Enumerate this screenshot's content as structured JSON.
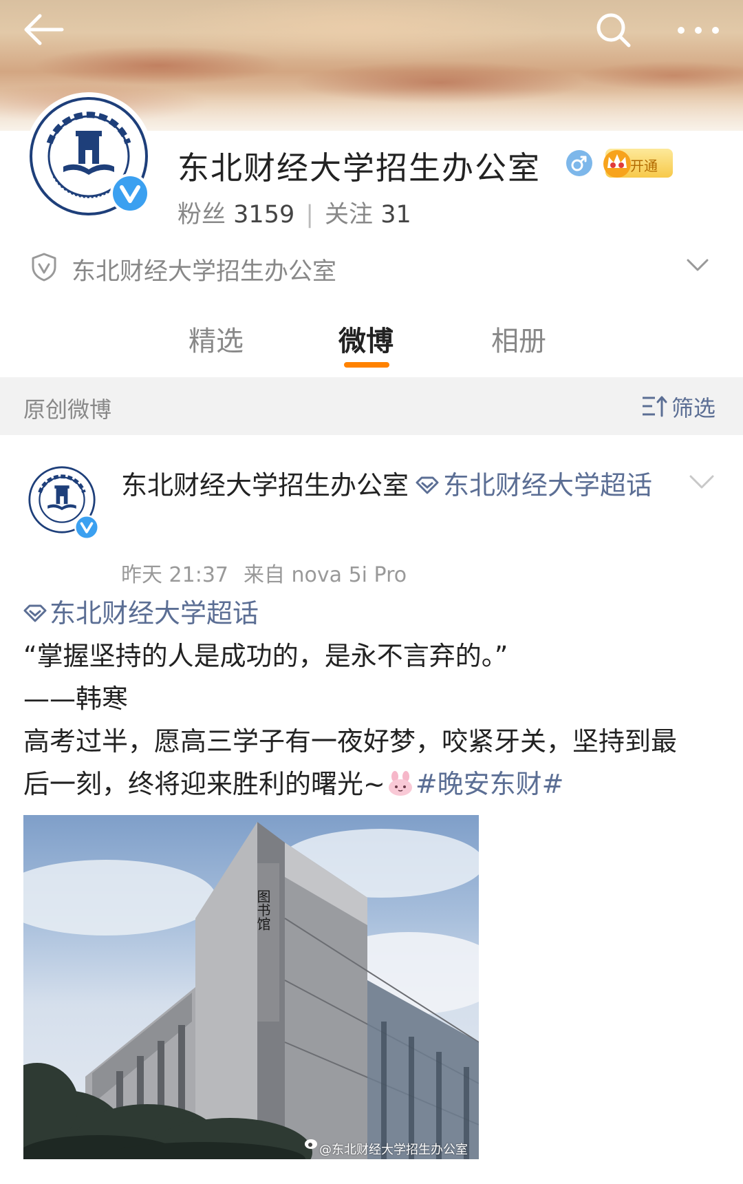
{
  "profile": {
    "name": "东北财经大学招生办公室",
    "vip_label": "开通",
    "fans_label": "粉丝",
    "fans_count": "3159",
    "follow_label": "关注",
    "follow_count": "31",
    "separator": "|",
    "certification": "东北财经大学招生办公室",
    "gender": "male",
    "verified": true
  },
  "tabs": [
    {
      "label": "精选",
      "active": false
    },
    {
      "label": "微博",
      "active": true
    },
    {
      "label": "相册",
      "active": false
    }
  ],
  "filter_bar": {
    "title": "原创微博",
    "filter_label": "筛选"
  },
  "post": {
    "author": "东北财经大学招生办公室",
    "topic_inline": "东北财经大学超话",
    "time": "昨天 21:37",
    "source": "来自 nova 5i Pro",
    "body": {
      "topic_link": "东北财经大学超话",
      "quote": "“掌握坚持的人是成功的，是永不言弃的。”",
      "attribution": "——韩寒",
      "text_line1": "高考过半，愿高三学子有一夜好梦，咬紧牙关，坚持到最",
      "text_line2": "后一刻，终将迎来胜利的曙光~",
      "hashtag": "#晚安东财#"
    },
    "image": {
      "sign_text": "图书馆",
      "watermark": "@东北财经大学招生办公室"
    }
  },
  "colors": {
    "accent_orange": "#ff8200",
    "link_blue": "#5b6e94",
    "verified_blue": "#3ba0f0",
    "filter_bg": "#f2f2f2"
  },
  "icons": [
    "back-arrow-icon",
    "search-icon",
    "more-icon",
    "verified-icon",
    "male-icon",
    "vip-crown-icon",
    "shield-icon",
    "chevron-down-icon",
    "filter-icon",
    "diamond-icon",
    "bunny-emoji-icon",
    "weibo-icon"
  ]
}
